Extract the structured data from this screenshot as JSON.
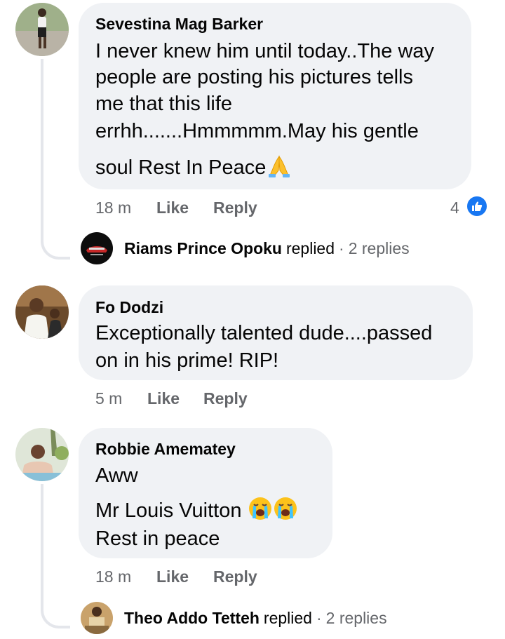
{
  "comments": [
    {
      "author": "Sevestina Mag Barker",
      "lines": [
        "I never knew him until today..The way",
        "people are posting his pictures tells",
        "me that this life",
        "errhh.......Hmmmmm.May his gentle",
        "soul Rest In Peace"
      ],
      "emoji_icon": "folded-hands-emoji",
      "time": "18 m",
      "like_label": "Like",
      "reply_label": "Reply",
      "reaction_count": "4",
      "reaction_icon": "thumbs-up-icon",
      "reply_summary": {
        "name": "Riams Prince Opoku",
        "verb": "replied",
        "count": "2 replies"
      }
    },
    {
      "author": "Fo Dodzi",
      "lines": [
        "Exceptionally talented dude....passed",
        "on in his prime! RIP!"
      ],
      "time": "5 m",
      "like_label": "Like",
      "reply_label": "Reply"
    },
    {
      "author": "Robbie Amematey",
      "lines": [
        "Aww",
        "Mr Louis Vuitton",
        "Rest in peace"
      ],
      "emoji_icon": "loudly-crying-face-emoji",
      "time": "18 m",
      "like_label": "Like",
      "reply_label": "Reply",
      "reply_summary": {
        "name": "Theo Addo Tetteh",
        "verb": "replied",
        "count": "2 replies"
      }
    }
  ],
  "colors": {
    "bubble": "#f0f2f5",
    "meta_text": "#65676b",
    "like_blue": "#1877f2",
    "thread_line": "#e4e6eb"
  }
}
